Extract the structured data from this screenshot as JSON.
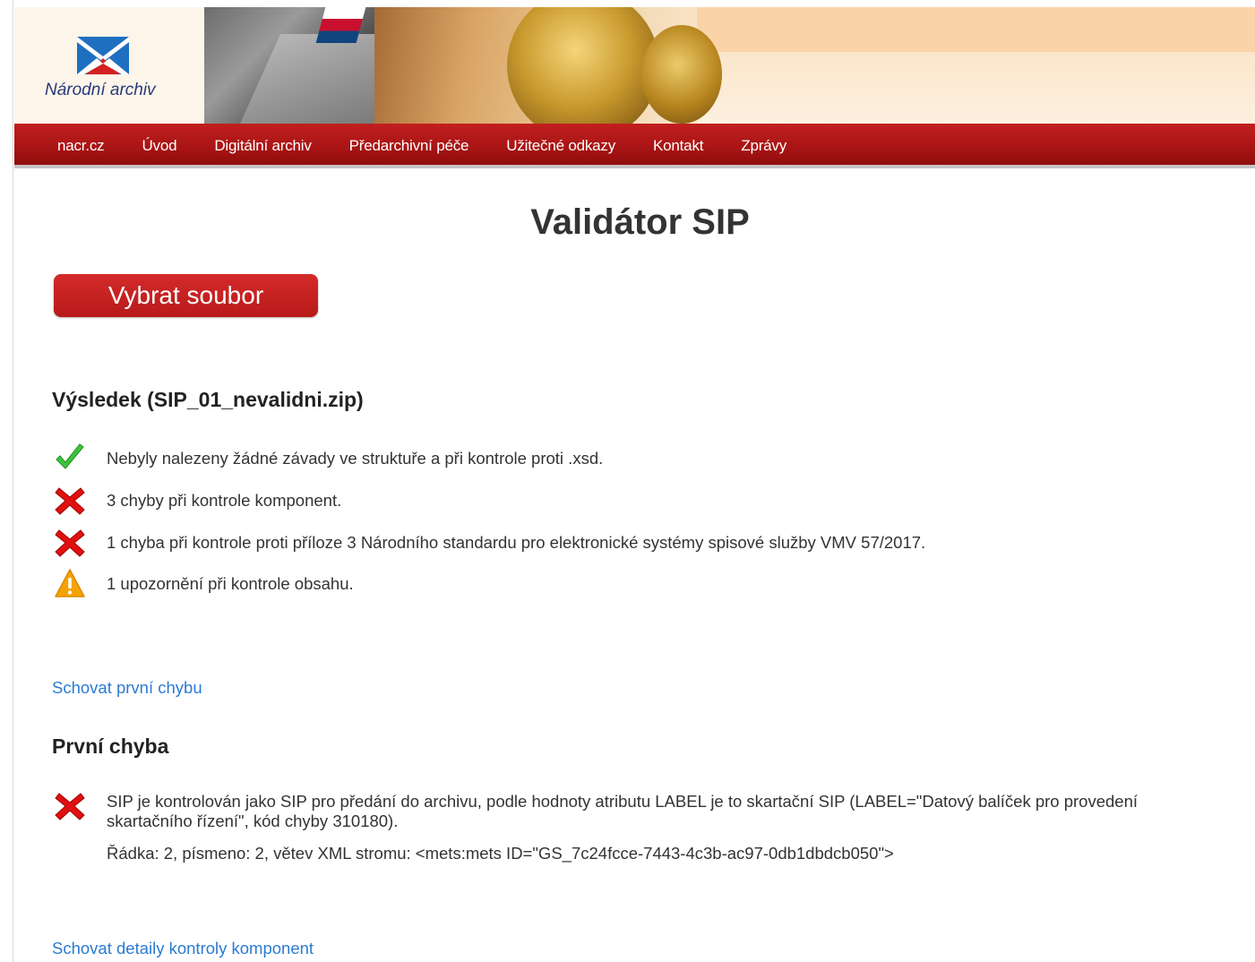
{
  "header": {
    "logo_text": "Národní archiv"
  },
  "nav": {
    "items": [
      {
        "label": "nacr.cz"
      },
      {
        "label": "Úvod"
      },
      {
        "label": "Digitální archiv"
      },
      {
        "label": "Předarchivní péče"
      },
      {
        "label": "Užitečné odkazy"
      },
      {
        "label": "Kontakt"
      },
      {
        "label": "Zprávy"
      }
    ]
  },
  "page": {
    "title": "Validátor SIP",
    "select_file_button": "Vybrat soubor"
  },
  "result": {
    "heading": "Výsledek (SIP_01_nevalidni.zip)",
    "items": [
      {
        "icon": "check-icon",
        "text": "Nebyly nalezeny žádné závady ve struktuře a při kontrole proti .xsd."
      },
      {
        "icon": "error-icon",
        "text": "3 chyby při kontrole komponent."
      },
      {
        "icon": "error-icon",
        "text": "1 chyba při kontrole proti příloze 3 Národního standardu pro elektronické systémy spisové služby VMV 57/2017."
      },
      {
        "icon": "warning-icon",
        "text": "1 upozornění při kontrole obsahu."
      }
    ]
  },
  "links": {
    "hide_first_error": "Schovat první chybu",
    "hide_component_details": "Schovat detaily kontroly komponent"
  },
  "first_error": {
    "heading": "První chyba",
    "icon": "error-icon",
    "message": "SIP je kontrolován jako SIP pro předání do archivu, podle hodnoty atributu LABEL je to skartační SIP (LABEL=\"Datový balíček pro provedení skartačního řízení\", kód chyby 310180).",
    "location": "Řádka: 2, písmeno: 2, větev XML stromu: <mets:mets ID=\"GS_7c24fcce-7443-4c3b-ac97-0db1dbdcb050\">"
  },
  "colors": {
    "nav_red": "#b81a1a",
    "button_red": "#c82020",
    "link_blue": "#2b7bd3",
    "check_green": "#3cc43c",
    "error_red": "#e01010",
    "warning_orange": "#f5a300"
  }
}
